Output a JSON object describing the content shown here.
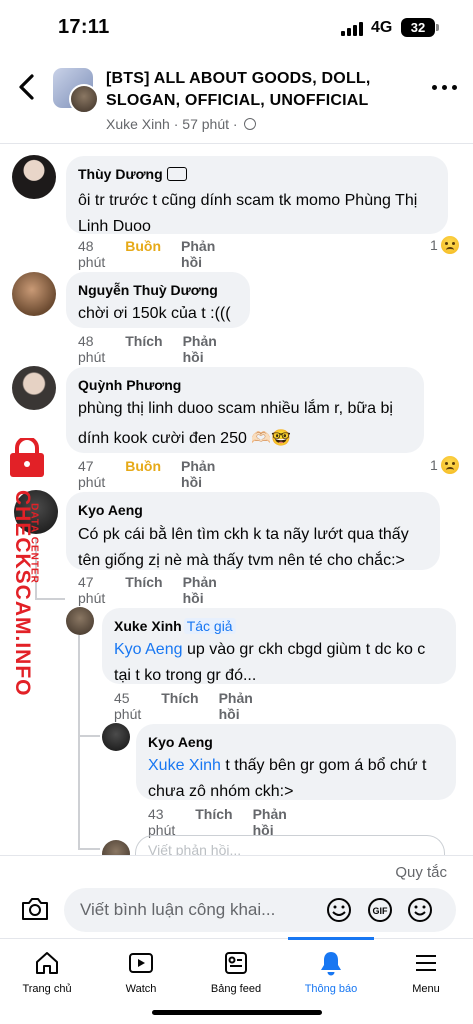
{
  "status_bar": {
    "time": "17:11",
    "network": "4G",
    "battery": "32"
  },
  "header": {
    "title": "[BTS] ALL ABOUT GOODS, DOLL, SLOGAN, OFFICIAL, UNOFFICIAL",
    "author": "Xuke Xinh",
    "time": "57 phút"
  },
  "comments": [
    {
      "author": "Thùy Dương",
      "text": "ôi tr trước t cũng dính scam tk momo Phùng Thị Linh Duoo",
      "time": "48 phút",
      "reaction_label": "Buồn",
      "reply_label": "Phản hồi",
      "reaction_count": "1"
    },
    {
      "author": "Nguyễn Thuỳ Dương",
      "text": "chời ơi 150k của t :(((",
      "time": "48 phút",
      "like_label": "Thích",
      "reply_label": "Phản hồi"
    },
    {
      "author": "Quỳnh Phương",
      "text": "phùng thị linh duoo scam nhiều lắm r, bữa bị dính kook cười đen 250 🫶🏻🤓",
      "time": "47 phút",
      "reaction_label": "Buồn",
      "reply_label": "Phản hồi",
      "reaction_count": "1"
    },
    {
      "author": "Kyo Aeng",
      "text": "Có pk cái bằ lên tìm ckh k ta nãy lướt qua thấy tên giống zị nè mà thấy tvm nên té cho chắc:>",
      "time": "47 phút",
      "like_label": "Thích",
      "reply_label": "Phản hồi"
    },
    {
      "author": "Xuke Xinh",
      "author_tag": "Tác giả",
      "mention": "Kyo Aeng",
      "text": " up vào gr ckh cbgd giùm t dc ko c tại t ko trong gr đó...",
      "time": "45 phút",
      "like_label": "Thích",
      "reply_label": "Phản hồi"
    },
    {
      "author": "Kyo Aeng",
      "mention": "Xuke Xinh",
      "text": " t thấy bên gr gom á bổ chứ t chưa zô nhóm ckh:>",
      "time": "43 phút",
      "like_label": "Thích",
      "reply_label": "Phản hồi"
    }
  ],
  "watermark": {
    "text": "CHECKSCAM.INFO",
    "subtext": "DATA CENTER"
  },
  "composer": {
    "partial_placeholder": "Viết phản hồi...",
    "rules_label": "Quy tắc",
    "placeholder": "Viết bình luận công khai..."
  },
  "tabs": [
    {
      "label": "Trang chủ",
      "icon": "home-icon"
    },
    {
      "label": "Watch",
      "icon": "watch-icon"
    },
    {
      "label": "Bảng feed",
      "icon": "feed-icon"
    },
    {
      "label": "Thông báo",
      "icon": "bell-icon",
      "active": true
    },
    {
      "label": "Menu",
      "icon": "menu-icon"
    }
  ],
  "colors": {
    "accent": "#1877f2",
    "sad": "#e6a917",
    "bubble": "#f0f2f5",
    "watermark": "#e22127"
  }
}
